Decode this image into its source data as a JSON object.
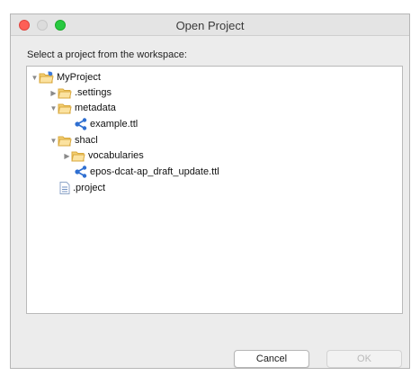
{
  "window": {
    "title": "Open Project"
  },
  "prompt": "Select a project from the workspace:",
  "tree": {
    "root": "MyProject",
    "settings": ".settings",
    "metadata": "metadata",
    "example": "example.ttl",
    "shacl": "shacl",
    "vocabularies": "vocabularies",
    "draft": "epos-dcat-ap_draft_update.ttl",
    "project": ".project"
  },
  "buttons": {
    "cancel": "Cancel",
    "ok": "OK"
  },
  "colors": {
    "close_light": "#fe5f57",
    "zoom_light": "#28c940",
    "folder": "#f2c462",
    "rdf_node": "#2f6fd1"
  },
  "icons": {
    "folder": "folder-icon",
    "project": "project-folder-icon",
    "rdf_file": "rdf-file-icon",
    "plain_file": "file-icon",
    "expanded": "triangle-down-icon",
    "collapsed": "triangle-right-icon"
  }
}
